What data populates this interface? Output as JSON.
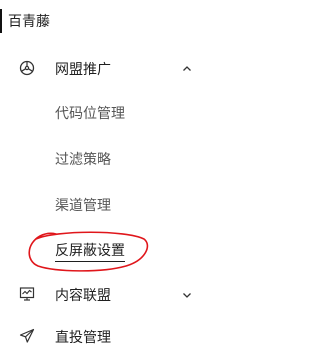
{
  "app": {
    "name": "百青藤"
  },
  "menu": {
    "groups": [
      {
        "label": "网盟推广",
        "icon": "network-icon",
        "expanded": true,
        "chevron": "chevron-up-icon",
        "items": [
          {
            "label": "代码位管理",
            "active": false
          },
          {
            "label": "过滤策略",
            "active": false
          },
          {
            "label": "渠道管理",
            "active": false
          },
          {
            "label": "反屏蔽设置",
            "active": true
          }
        ]
      },
      {
        "label": "内容联盟",
        "icon": "monitor-chart-icon",
        "expanded": false,
        "chevron": "chevron-down-icon"
      },
      {
        "label": "直投管理",
        "icon": "send-icon",
        "expanded": false
      }
    ]
  },
  "colors": {
    "annotation": "#e0161b",
    "text_primary": "#1f1f1f",
    "text_secondary": "#555555"
  }
}
